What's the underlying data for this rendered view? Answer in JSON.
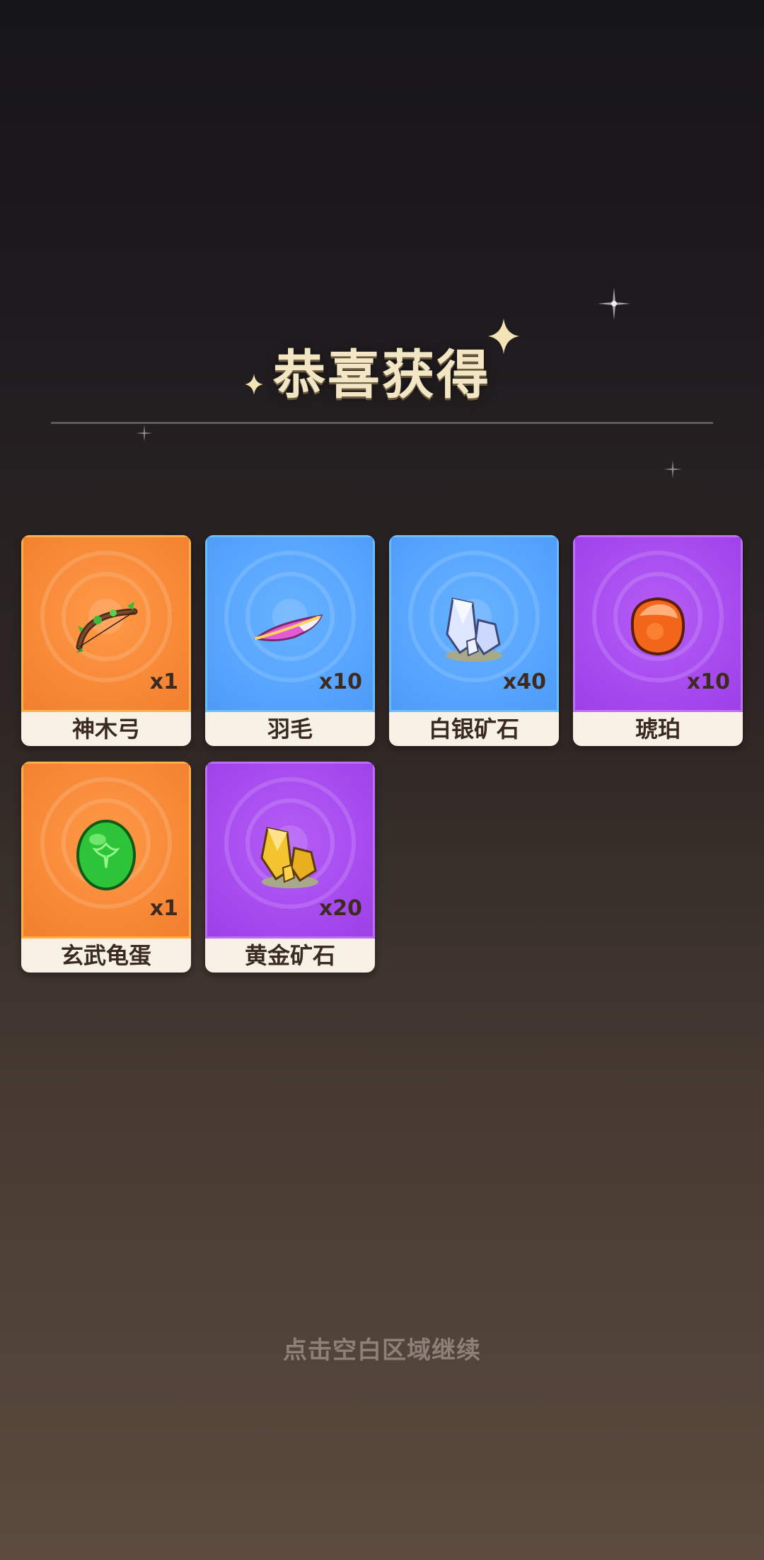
{
  "title": "恭喜获得",
  "hint": "点击空白区域继续",
  "colors": {
    "orange": "#f88a38",
    "blue": "#58a6ff",
    "purple": "#a84cf0",
    "label_bg": "#f8f2e6",
    "title": "#f3e6c4"
  },
  "rewards": [
    {
      "name": "神木弓",
      "quantity": "x1",
      "rarity": "orange",
      "icon": "wooden-bow-icon"
    },
    {
      "name": "羽毛",
      "quantity": "x10",
      "rarity": "blue",
      "icon": "feather-icon"
    },
    {
      "name": "白银矿石",
      "quantity": "x40",
      "rarity": "blue",
      "icon": "silver-ore-icon"
    },
    {
      "name": "琥珀",
      "quantity": "x10",
      "rarity": "purple",
      "icon": "amber-icon"
    },
    {
      "name": "玄武龟蛋",
      "quantity": "x1",
      "rarity": "orange",
      "icon": "turtle-egg-icon"
    },
    {
      "name": "黄金矿石",
      "quantity": "x20",
      "rarity": "purple",
      "icon": "gold-ore-icon"
    }
  ]
}
